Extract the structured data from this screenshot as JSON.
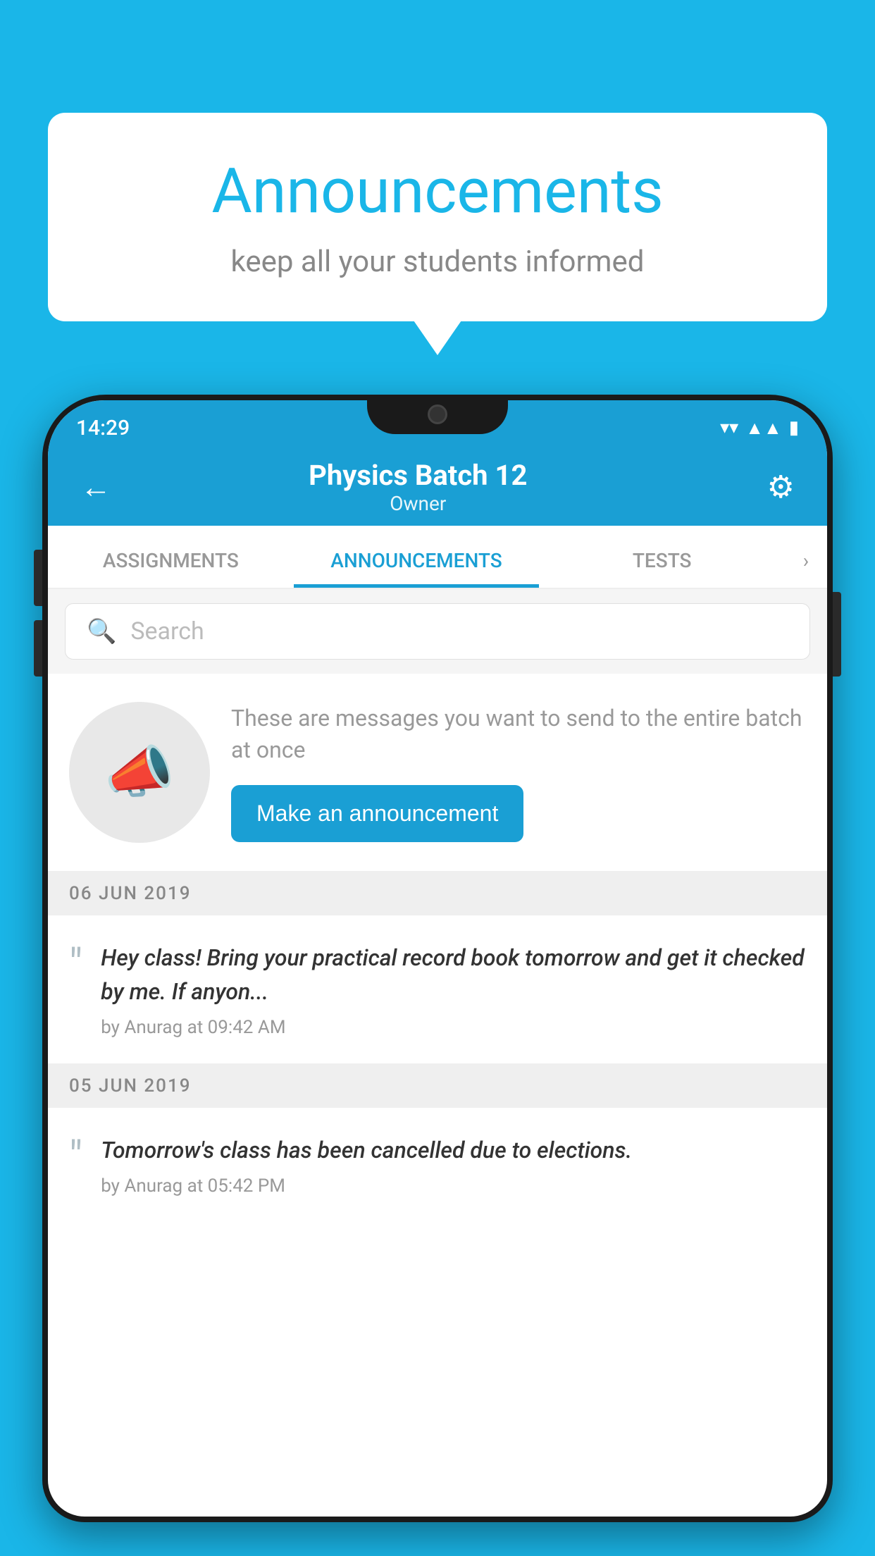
{
  "bubble": {
    "title": "Announcements",
    "subtitle": "keep all your students informed"
  },
  "phone": {
    "statusBar": {
      "time": "14:29"
    },
    "appBar": {
      "title": "Physics Batch 12",
      "subtitle": "Owner",
      "backLabel": "←",
      "settingsLabel": "⚙"
    },
    "tabs": [
      {
        "label": "ASSIGNMENTS",
        "active": false
      },
      {
        "label": "ANNOUNCEMENTS",
        "active": true
      },
      {
        "label": "TESTS",
        "active": false
      }
    ],
    "search": {
      "placeholder": "Search"
    },
    "promptSection": {
      "description": "These are messages you want to send to the entire batch at once",
      "buttonLabel": "Make an announcement"
    },
    "announcements": [
      {
        "date": "06  JUN  2019",
        "text": "Hey class! Bring your practical record book tomorrow and get it checked by me. If anyon...",
        "meta": "by Anurag at 09:42 AM"
      },
      {
        "date": "05  JUN  2019",
        "text": "Tomorrow's class has been cancelled due to elections.",
        "meta": "by Anurag at 05:42 PM"
      }
    ]
  }
}
